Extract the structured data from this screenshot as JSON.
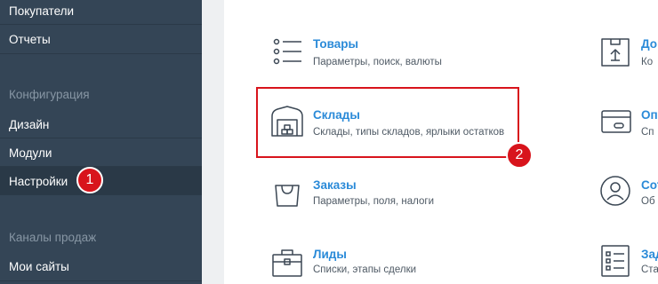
{
  "sidebar": {
    "items_top": [
      {
        "label": "Покупатели"
      },
      {
        "label": "Отчеты"
      }
    ],
    "config_section": {
      "title": "Конфигурация",
      "items": [
        {
          "label": "Дизайн"
        },
        {
          "label": "Модули"
        },
        {
          "label": "Настройки"
        }
      ]
    },
    "sales_section": {
      "title": "Каналы продаж",
      "items": [
        {
          "label": "Мои сайты"
        }
      ]
    }
  },
  "settings_cards": [
    {
      "title": "Товары",
      "desc": "Параметры, поиск, валюты",
      "icon": "list-icon"
    },
    {
      "title": "Склады",
      "desc": "Склады, типы складов, ярлыки остатков",
      "icon": "warehouse-icon"
    },
    {
      "title": "Заказы",
      "desc": "Параметры, поля, налоги",
      "icon": "shopping-bag-icon"
    },
    {
      "title": "Лиды",
      "desc": "Списки, этапы сделки",
      "icon": "briefcase-icon"
    }
  ],
  "right_cards": [
    {
      "title": "До",
      "desc": "Ко",
      "icon": "box-upload-icon"
    },
    {
      "title": "Оп",
      "desc": "Сп",
      "icon": "credit-card-icon"
    },
    {
      "title": "Сот",
      "desc": "Об",
      "icon": "user-circle-icon"
    },
    {
      "title": "Зад",
      "desc": "Ста",
      "icon": "checklist-icon"
    }
  ],
  "annotations": {
    "badge_1": "1",
    "badge_2": "2",
    "highlight_color": "#d8141c"
  },
  "colors": {
    "sidebar_bg": "#344556",
    "link_blue": "#2a8ad8"
  }
}
